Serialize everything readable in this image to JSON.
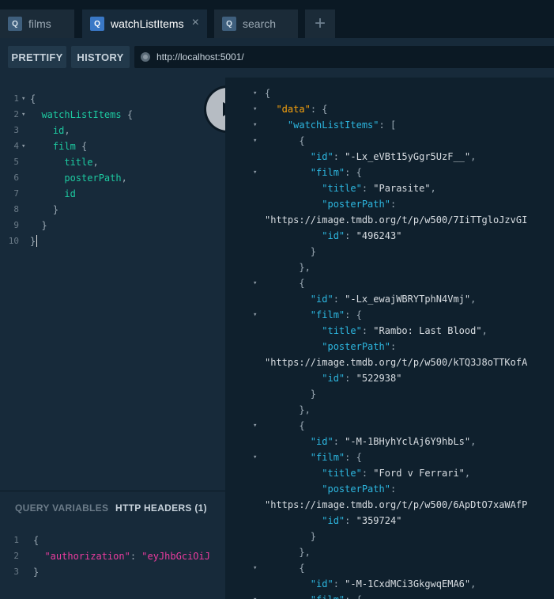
{
  "tabs": [
    {
      "icon": "Q",
      "label": "films"
    },
    {
      "icon": "Q",
      "label": "watchListItems",
      "close": "×"
    },
    {
      "icon": "Q",
      "label": "search"
    }
  ],
  "add_tab": "+",
  "toolbar": {
    "prettify": "PRETTIFY",
    "history": "HISTORY",
    "url": "http://localhost:5001/"
  },
  "query_lines": [
    {
      "n": "1",
      "text": "{"
    },
    {
      "n": "2",
      "text": "  watchListItems {"
    },
    {
      "n": "3",
      "text": "    id,"
    },
    {
      "n": "4",
      "text": "    film {"
    },
    {
      "n": "5",
      "text": "      title,"
    },
    {
      "n": "6",
      "text": "      posterPath,"
    },
    {
      "n": "7",
      "text": "      id"
    },
    {
      "n": "8",
      "text": "    }"
    },
    {
      "n": "9",
      "text": "  }"
    },
    {
      "n": "10",
      "text": "}"
    }
  ],
  "vars_tabs": {
    "query_variables": "QUERY VARIABLES",
    "http_headers": "HTTP HEADERS (1)"
  },
  "headers_lines": [
    {
      "n": "1",
      "text": "{"
    },
    {
      "n": "2",
      "key": "\"authorization\"",
      "sep": ": ",
      "value": "\"eyJhbGciOiJ"
    },
    {
      "n": "3",
      "text": "}"
    }
  ],
  "result_lines": [
    "{",
    "  \"data\": {",
    "    \"watchListItems\": [",
    "      {",
    "        \"id\": \"-Lx_eVBt15yGgr5UzF__\",",
    "        \"film\": {",
    "          \"title\": \"Parasite\",",
    "          \"posterPath\":",
    "\"https://image.tmdb.org/t/p/w500/7IiTTgloJzvGI",
    "          \"id\": \"496243\"",
    "        }",
    "      },",
    "      {",
    "        \"id\": \"-Lx_ewajWBRYTphN4Vmj\",",
    "        \"film\": {",
    "          \"title\": \"Rambo: Last Blood\",",
    "          \"posterPath\":",
    "\"https://image.tmdb.org/t/p/w500/kTQ3J8oTTKofA",
    "          \"id\": \"522938\"",
    "        }",
    "      },",
    "      {",
    "        \"id\": \"-M-1BHyhYclAj6Y9hbLs\",",
    "        \"film\": {",
    "          \"title\": \"Ford v Ferrari\",",
    "          \"posterPath\":",
    "\"https://image.tmdb.org/t/p/w500/6ApDtO7xaWAfP",
    "          \"id\": \"359724\"",
    "        }",
    "      },",
    "      {",
    "        \"id\": \"-M-1CxdMCi3GkgwqEMA6\",",
    "        \"film\": {"
  ],
  "colors": {
    "keyword": "#2bd6b2",
    "key": "#2db7e0",
    "top_key": "#f8a20d",
    "header_key": "#ec3c9f",
    "string": "#d8dde2"
  }
}
